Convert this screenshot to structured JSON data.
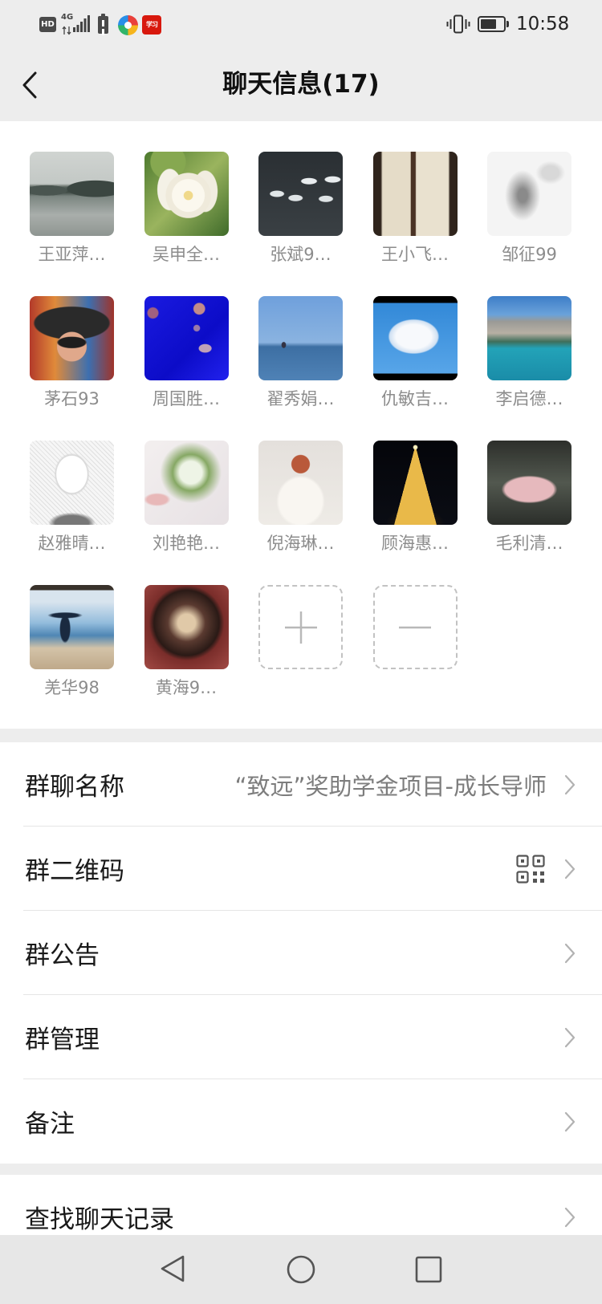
{
  "status_bar": {
    "hd_label": "HD",
    "network_label": "4G",
    "xuexi_logo_text": "学习",
    "time": "10:58",
    "battery_level": 0.7,
    "left_icons": {
      "hd": "hd-icon",
      "signal": "signal-4g-icon",
      "alert": "battery-alert-icon",
      "app1": "pinwheel-app-icon",
      "app2": "xuexi-app-icon"
    },
    "right_icons": {
      "vibrate": "vibrate-icon",
      "battery": "battery-icon"
    }
  },
  "header": {
    "title": "聊天信息(17)",
    "back_icon": "chevron-left-icon"
  },
  "members": [
    {
      "name": "王亚萍…"
    },
    {
      "name": "吴申全…"
    },
    {
      "name": "张斌9…"
    },
    {
      "name": "王小飞…"
    },
    {
      "name": "邹征99"
    },
    {
      "name": "茅石93"
    },
    {
      "name": "周国胜…"
    },
    {
      "name": "翟秀娟…"
    },
    {
      "name": "仇敏吉…"
    },
    {
      "name": "李启德…"
    },
    {
      "name": "赵雅晴…"
    },
    {
      "name": "刘艳艳…"
    },
    {
      "name": "倪海琳…"
    },
    {
      "name": "顾海惠…"
    },
    {
      "name": "毛利清…"
    },
    {
      "name": "羌华98"
    },
    {
      "name": "黄海9…"
    }
  ],
  "member_actions": {
    "add_icon": "plus-icon",
    "remove_icon": "minus-icon"
  },
  "settings": [
    {
      "label": "群聊名称",
      "value": "“致远”奖助学金项目-成长导师"
    },
    {
      "label": "群二维码",
      "icon": "qr-code-icon"
    },
    {
      "label": "群公告"
    },
    {
      "label": "群管理"
    },
    {
      "label": "备注"
    }
  ],
  "search_history": {
    "label": "查找聊天记录"
  },
  "nav_bar": {
    "back_icon": "triangle-back-icon",
    "home_icon": "circle-home-icon",
    "recents_icon": "square-recents-icon"
  },
  "colors": {
    "page_background": "#ededed",
    "surface": "#ffffff",
    "text_primary": "#191919",
    "text_secondary": "#8c8c8c",
    "divider": "#e5e5e5",
    "chevron": "#b2b2b2",
    "nav_bar": "#e7e7e7"
  }
}
